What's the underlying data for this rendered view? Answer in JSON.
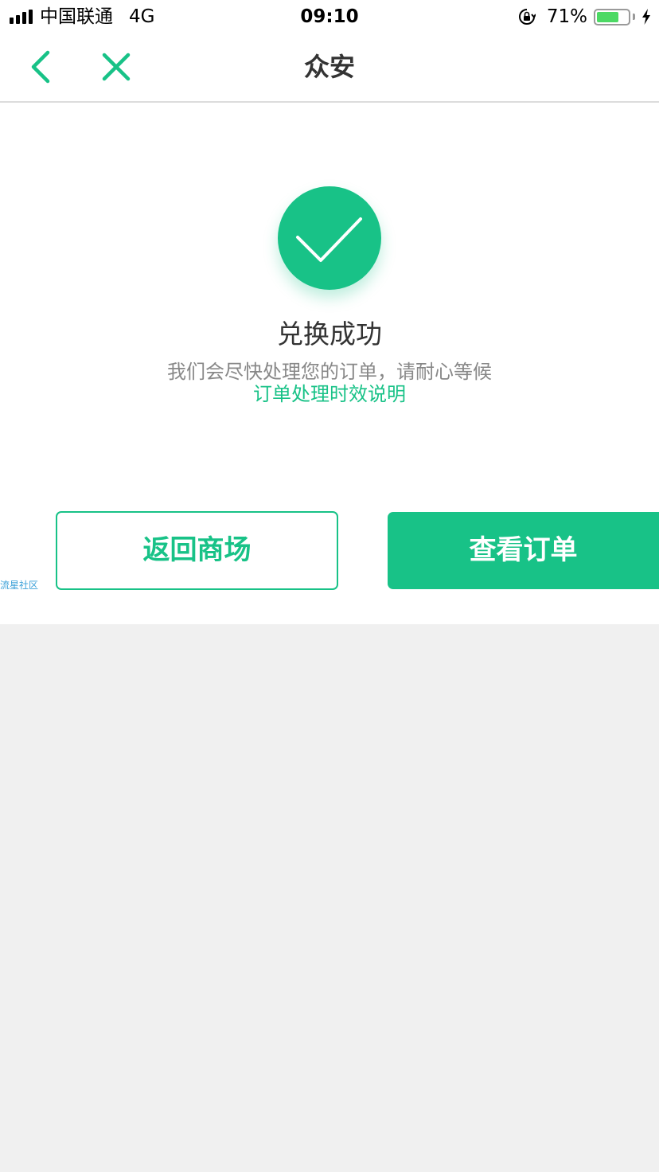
{
  "status_bar": {
    "carrier": "中国联通",
    "network": "4G",
    "time": "09:10",
    "battery_percent": "71%",
    "battery_level": 0.71,
    "icons": [
      "signal-icon",
      "rotation-lock-icon",
      "battery-icon",
      "charging-bolt-icon"
    ]
  },
  "nav": {
    "title": "众安",
    "back_icon": "chevron-left-icon",
    "close_icon": "close-icon"
  },
  "result": {
    "icon": "check-circle-icon",
    "title": "兑换成功",
    "description": "我们会尽快处理您的订单，请耐心等候",
    "link": "订单处理时效说明"
  },
  "actions": {
    "back_to_mall": "返回商场",
    "view_order": "查看订单"
  },
  "watermark": "流星社区",
  "colors": {
    "accent": "#18c287",
    "battery_green": "#4cd964",
    "page_background": "#f0f0f0"
  }
}
